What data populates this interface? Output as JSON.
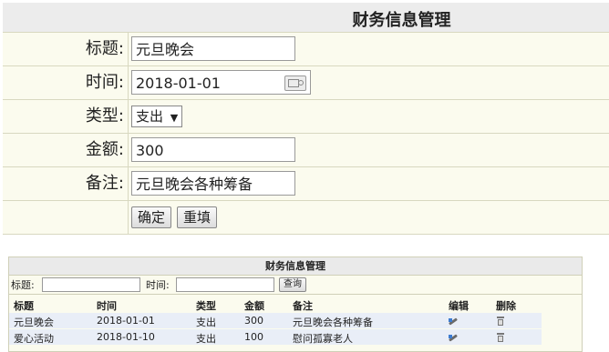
{
  "form": {
    "title": "财务信息管理",
    "fields": {
      "title_label": "标题:",
      "title_value": "元旦晚会",
      "time_label": "时间:",
      "time_value": "2018-01-01",
      "type_label": "类型:",
      "type_value": "支出",
      "amount_label": "金额:",
      "amount_value": "300",
      "note_label": "备注:",
      "note_value": "元旦晚会各种筹备"
    },
    "confirm_label": "确定",
    "reset_label": "重填"
  },
  "list": {
    "title": "财务信息管理",
    "search": {
      "title_label": "标题:",
      "time_label": "时间:",
      "button_label": "查询"
    },
    "columns": [
      "标题",
      "时间",
      "类型",
      "金额",
      "备注",
      "编辑",
      "删除"
    ],
    "rows": [
      [
        "元旦晚会",
        "2018-01-01",
        "支出",
        "300",
        "元旦晚会各种筹备"
      ],
      [
        "爱心活动",
        "2018-01-10",
        "支出",
        "100",
        "慰问孤寡老人"
      ]
    ]
  }
}
